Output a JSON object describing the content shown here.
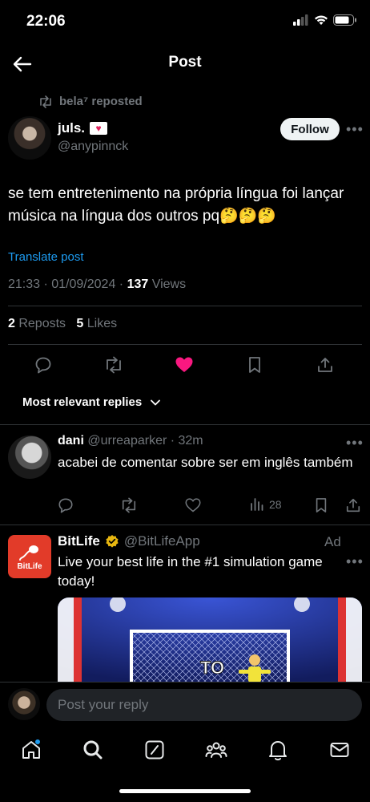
{
  "status_bar": {
    "time": "22:06"
  },
  "header": {
    "title": "Post"
  },
  "repost": {
    "text": "bela⁷ reposted"
  },
  "post": {
    "author_name": "juls.",
    "author_handle": "@anypinnck",
    "follow_label": "Follow",
    "text": "se tem entretenimento na própria língua foi lançar música na língua dos outros pq🤔🤔🤔",
    "translate_label": "Translate post",
    "timestamp": "21:33 · 01/09/2024 · ",
    "views_count": "137",
    "views_label": " Views",
    "reposts_count": "2",
    "reposts_label": " Reposts",
    "likes_count": "5",
    "likes_label": " Likes",
    "liked": true
  },
  "replies_sort": {
    "label": "Most relevant replies"
  },
  "reply": {
    "name": "dani",
    "handle_time": "@urreaparker · 32m",
    "text": "acabei de comentar sobre ser em inglês também",
    "views_count": "28"
  },
  "ad": {
    "logo_text": "BitLife",
    "name": "BitLife",
    "handle": "@BitLifeApp",
    "label": "Ad",
    "text": "Live your best life in the #1 simulation game today!",
    "media_text": "TO"
  },
  "composer": {
    "placeholder": "Post your reply"
  },
  "colors": {
    "accent": "#1d9bf0",
    "like": "#f91880",
    "background": "#000000",
    "muted": "#71767b"
  },
  "icons": [
    "back-arrow-icon",
    "repost-icon",
    "more-icon",
    "reply-icon",
    "like-icon",
    "bookmark-icon",
    "share-icon",
    "chevron-down-icon",
    "views-icon",
    "verified-icon",
    "home-icon",
    "search-icon",
    "grok-icon",
    "communities-icon",
    "notifications-icon",
    "messages-icon"
  ]
}
